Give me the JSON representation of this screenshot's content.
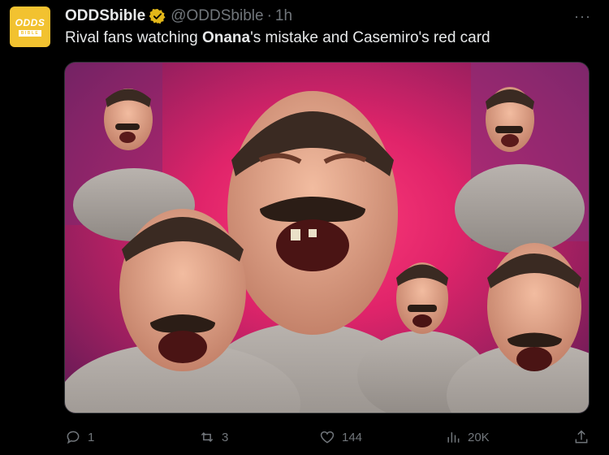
{
  "account": {
    "avatar_logo_top": "ODDS",
    "avatar_logo_bottom": "BIBLE",
    "name": "ODDSbible",
    "handle": "@ODDSbible",
    "separator": "·",
    "time": "1h"
  },
  "post": {
    "text_before": "Rival fans watching ",
    "text_bold": "Onana",
    "text_after": "'s mistake and Casemiro's red card",
    "more_label": "···"
  },
  "media": {
    "icon": "laughing-meme-collage"
  },
  "actions": {
    "reply_count": "1",
    "repost_count": "3",
    "like_count": "144",
    "views_count": "20K"
  },
  "colors": {
    "background": "#000000",
    "text": "#e7e9ea",
    "muted": "#71767b",
    "verified_gold": "#e2b719",
    "brand_yellow": "#f2c230"
  }
}
